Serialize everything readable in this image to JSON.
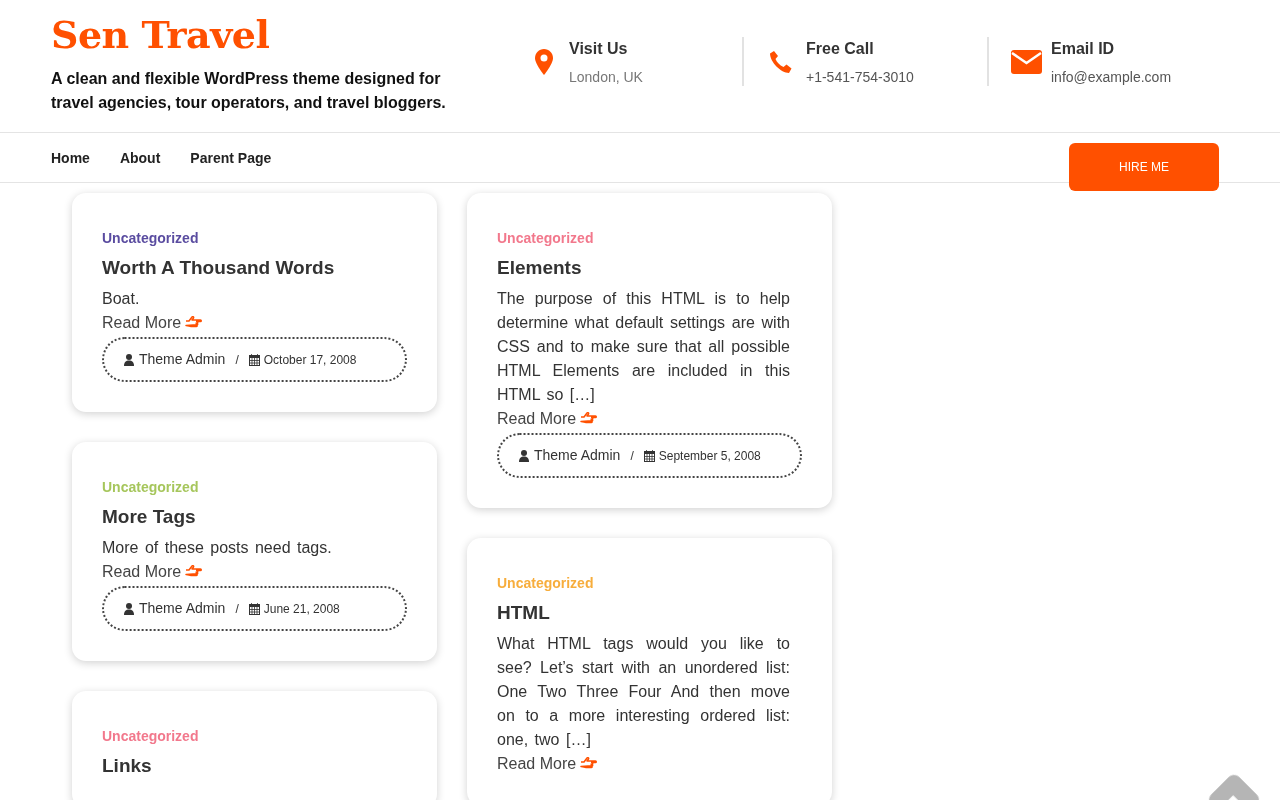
{
  "site": {
    "title": "Sen Travel",
    "tagline": "A clean and flexible WordPress theme designed for travel agencies, tour operators, and travel bloggers."
  },
  "contacts": [
    {
      "kind": "pin",
      "label": "Visit Us",
      "value": "London, UK"
    },
    {
      "kind": "phone",
      "label": "Free Call",
      "value": "+1-541-754-3010"
    },
    {
      "kind": "mail",
      "label": "Email ID",
      "value": "info@example.com"
    }
  ],
  "nav": [
    {
      "label": "Home"
    },
    {
      "label": "About"
    },
    {
      "label": "Parent Page"
    }
  ],
  "hire_button": "HIRE ME",
  "meta_separator": "/",
  "columns": [
    [
      {
        "category": "Uncategorized",
        "color": "#5a4ca0",
        "title": "Worth A Thousand Words",
        "excerpt": "Boat.",
        "read_more": "Read More",
        "author": "Theme Admin",
        "date": "October 17, 2008"
      },
      {
        "category": "Uncategorized",
        "color": "#a6c65c",
        "title": "More Tags",
        "excerpt": "More of these posts need tags.",
        "read_more": "Read More",
        "author": "Theme Admin",
        "date": "June 21, 2008"
      },
      {
        "category": "Uncategorized",
        "color": "#f2788c",
        "title": "Links"
      }
    ],
    [
      {
        "category": "Uncategorized",
        "color": "#f2788c",
        "title": "Elements",
        "excerpt": "The purpose of this HTML is to help determine what default settings are with CSS and to make sure that all possible HTML Elements are included in this HTML so […]",
        "read_more": "Read More",
        "author": "Theme Admin",
        "date": "September 5, 2008"
      },
      {
        "category": "Uncategorized",
        "color": "#f7ad3c",
        "title": "HTML",
        "excerpt": "What HTML tags would you like to see? Let’s start with an unordered list: One Two Three Four And then move on to a more interesting ordered list: one, two […]",
        "read_more": "Read More"
      }
    ]
  ]
}
